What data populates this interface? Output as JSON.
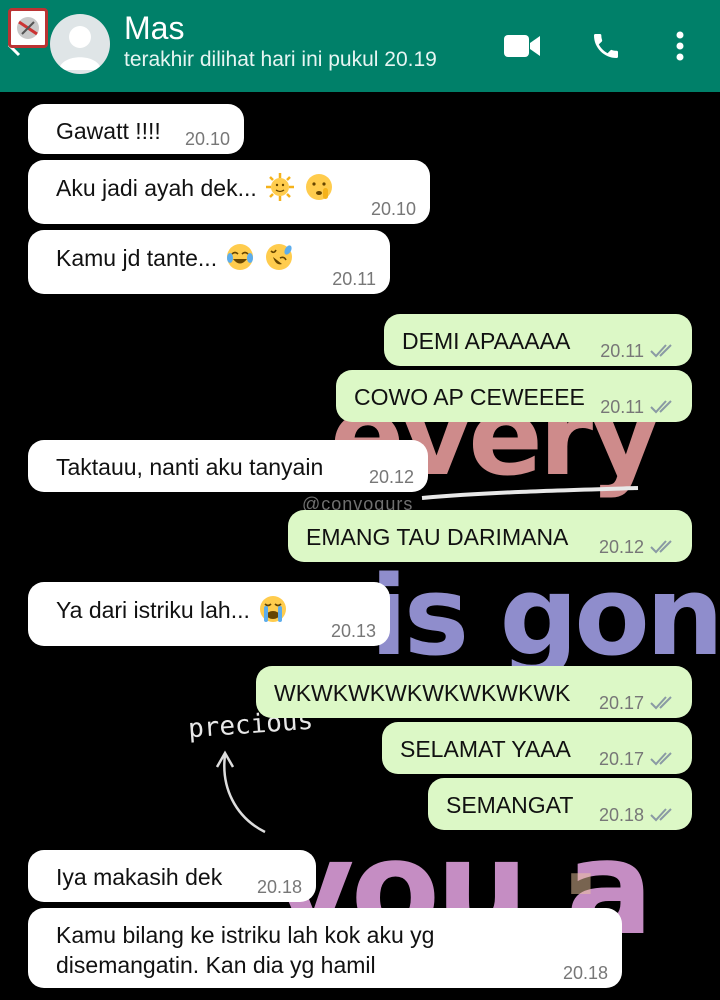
{
  "header": {
    "contact_name": "Mas",
    "last_seen": "terakhir dilihat hari ini pukul 20.19"
  },
  "wallpaper": {
    "watermark": "@convoqurs",
    "doodle_text": "precious"
  },
  "messages": [
    {
      "direction": "in",
      "text": "Gawatt !!!!",
      "time": "20.10"
    },
    {
      "direction": "in",
      "text": "Aku jadi ayah dek...",
      "emojis": [
        "sun-with-face-emoji",
        "shushing-face-emoji"
      ],
      "time": "20.10"
    },
    {
      "direction": "in",
      "text": "Kamu jd tante...",
      "emojis": [
        "joy-emoji",
        "rofl-emoji"
      ],
      "time": "20.11"
    },
    {
      "direction": "out",
      "text": "DEMI APAAAAA",
      "time": "20.11",
      "status": "read"
    },
    {
      "direction": "out",
      "text": "COWO AP CEWEEEE",
      "time": "20.11",
      "status": "read"
    },
    {
      "direction": "in",
      "text": "Taktauu, nanti aku tanyain",
      "time": "20.12"
    },
    {
      "direction": "out",
      "text": "EMANG TAU DARIMANA",
      "time": "20.12",
      "status": "read"
    },
    {
      "direction": "in",
      "text": "Ya dari istriku lah...",
      "emojis": [
        "crying-emoji"
      ],
      "time": "20.13"
    },
    {
      "direction": "out",
      "text": "WKWKWKWKWKWKWKWK",
      "time": "20.17",
      "status": "read"
    },
    {
      "direction": "out",
      "text": "SELAMAT YAAA",
      "time": "20.17",
      "status": "read"
    },
    {
      "direction": "out",
      "text": "SEMANGAT",
      "time": "20.18",
      "status": "read"
    },
    {
      "direction": "in",
      "text": "Iya makasih dek",
      "time": "20.18"
    },
    {
      "direction": "in",
      "text": "Kamu bilang ke istriku lah kok aku yg disemangatin. Kan dia yg hamil",
      "time": "20.18"
    }
  ],
  "colors": {
    "header_bg": "#008069",
    "incoming_bubble": "#ffffff",
    "outgoing_bubble": "#dcf8c6",
    "read_ticks": "#8a9aa4"
  },
  "icons": [
    "back-arrow-icon",
    "video-call-icon",
    "voice-call-icon",
    "more-options-icon"
  ]
}
